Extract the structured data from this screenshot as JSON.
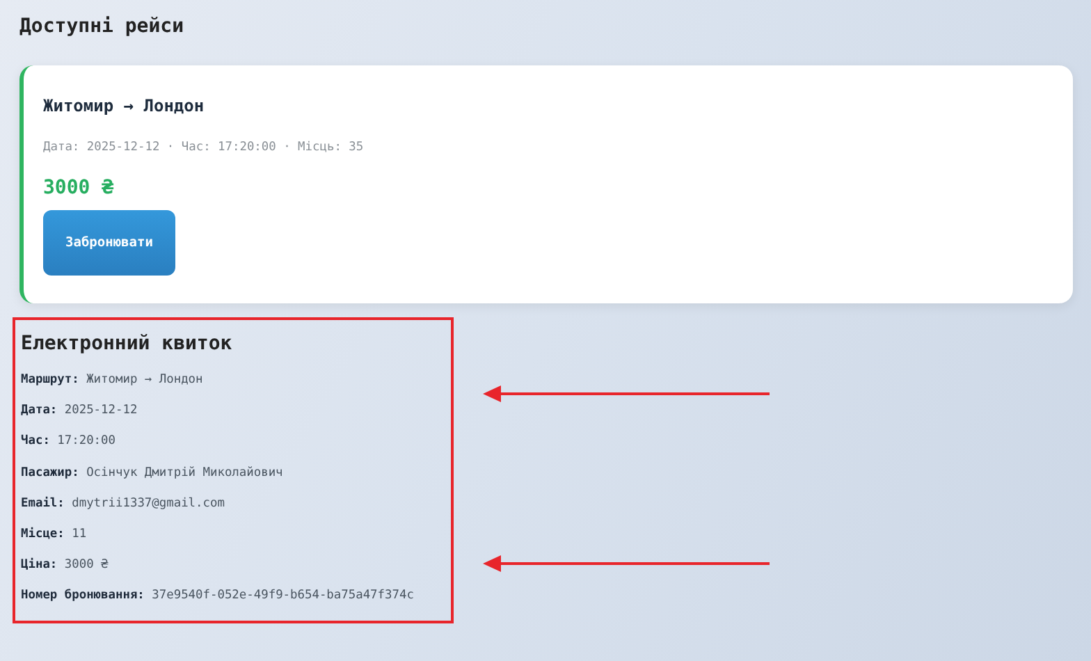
{
  "heading": "Доступні рейси",
  "flights": [
    {
      "route": "Житомир → Лондон",
      "details": "Дата: 2025-12-12 · Час: 17:20:00 · Місць: 35",
      "price": "3000 ₴",
      "button": "Забронювати"
    }
  ],
  "ticket": {
    "title": "Електронний квиток",
    "lines": [
      "**Маршрут:** Житомир → Лондон",
      "**Дата:** 2025-12-12",
      "**Час:** 17:20:00",
      "**Пасажир:** Осінчук Дмитрій Миколайович",
      "**Email:** dmytrii1337@gmail.com",
      "**Місце:** 11",
      "**Ціна:** 3000 ₴",
      "**Номер бронювання:** 37e9540f-052e-49f9-b654-ba75a47f374c"
    ]
  }
}
